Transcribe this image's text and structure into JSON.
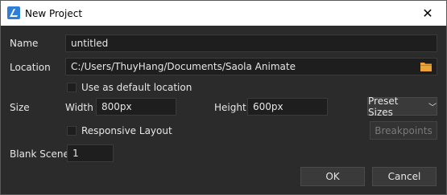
{
  "window": {
    "title": "New Project",
    "close_icon": "close-icon",
    "app_icon": "saola-icon"
  },
  "form": {
    "name_label": "Name",
    "name_value": "untitled",
    "location_label": "Location",
    "location_value": "C:/Users/ThuyHang/Documents/Saola Animate",
    "folder_icon": "folder-icon",
    "default_location_label": "Use as default location",
    "size_label": "Size",
    "width_label": "Width",
    "width_value": "800px",
    "height_label": "Height",
    "height_value": "600px",
    "preset_label": "Preset Sizes",
    "responsive_label": "Responsive Layout",
    "breakpoints_label": "Breakpoints",
    "blank_scene_label": "Blank Scene",
    "blank_scene_value": "1"
  },
  "buttons": {
    "ok": "OK",
    "cancel": "Cancel"
  },
  "colors": {
    "folder": "#e8a33d",
    "accent": "#2f7fd6"
  }
}
